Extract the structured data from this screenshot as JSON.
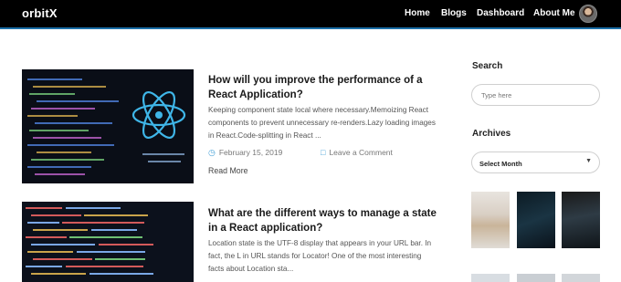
{
  "header": {
    "logo": "orbitX",
    "nav": [
      "Home",
      "Blogs",
      "Dashboard",
      "About Me"
    ]
  },
  "posts": [
    {
      "title": "How will you improve the performance of a React Application?",
      "excerpt": "Keeping component state local where necessary.Memoizing React components to prevent unnecessary re-renders.Lazy loading images in React.Code-splitting in React ...",
      "date": "February 15, 2019",
      "comment_link": "Leave a Comment",
      "read_more": "Read More"
    },
    {
      "title": "What are the different ways to manage a state in a React application?",
      "excerpt": "Location state is the UTF-8 display that appears in your URL bar. In fact, the L in URL stands for Locator! One of the most interesting facts about Location sta..."
    }
  ],
  "sidebar": {
    "search_heading": "Search",
    "search_placeholder": "Type here",
    "archives_heading": "Archives",
    "archives_select": "Select Month"
  },
  "icons": {
    "date": "calendar-icon",
    "comment": "comment-icon",
    "select": "chevron-down-icon"
  },
  "colors": {
    "header_bg": "#000000",
    "accent": "#1b6fa8",
    "meta_icon": "#4aa3d8"
  }
}
